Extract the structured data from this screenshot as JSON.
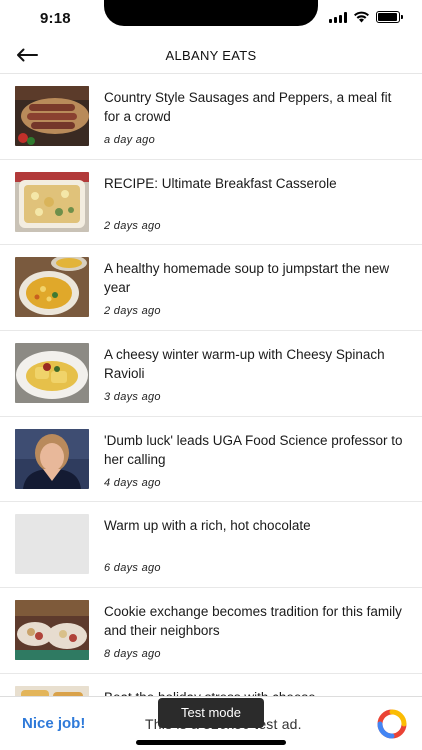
{
  "status_bar": {
    "time": "9:18",
    "battery_level": 0.95
  },
  "header": {
    "back_icon": "arrow-left-icon",
    "title": "ALBANY EATS"
  },
  "articles": [
    {
      "title": "Country Style Sausages and Peppers, a meal fit for a crowd",
      "ago": "a day ago",
      "thumbnail": "sausages-photo"
    },
    {
      "title": "RECIPE: Ultimate Breakfast Casserole",
      "ago": "2 days ago",
      "thumbnail": "casserole-photo"
    },
    {
      "title": "A healthy homemade soup to jumpstart the new year",
      "ago": "2 days ago",
      "thumbnail": "soup-photo"
    },
    {
      "title": "A cheesy winter warm-up with Cheesy Spinach Ravioli",
      "ago": "3 days ago",
      "thumbnail": "ravioli-photo"
    },
    {
      "title": "'Dumb luck' leads UGA Food Science professor to her calling",
      "ago": "4 days ago",
      "thumbnail": "professor-portrait"
    },
    {
      "title": "Warm up with a rich, hot chocolate",
      "ago": "6 days ago",
      "thumbnail": "placeholder"
    },
    {
      "title": "Cookie exchange becomes tradition for this family and their neighbors",
      "ago": "8 days ago",
      "thumbnail": "cookies-photo"
    },
    {
      "title": "Beat the holiday stress with cheese",
      "ago": "",
      "thumbnail": "cheese-photo"
    }
  ],
  "ad": {
    "left_text": "Nice job!",
    "middle_text": "This is a 320x50 test ad.",
    "test_badge": "Test mode",
    "logo_icon": "admob-logo-icon"
  }
}
